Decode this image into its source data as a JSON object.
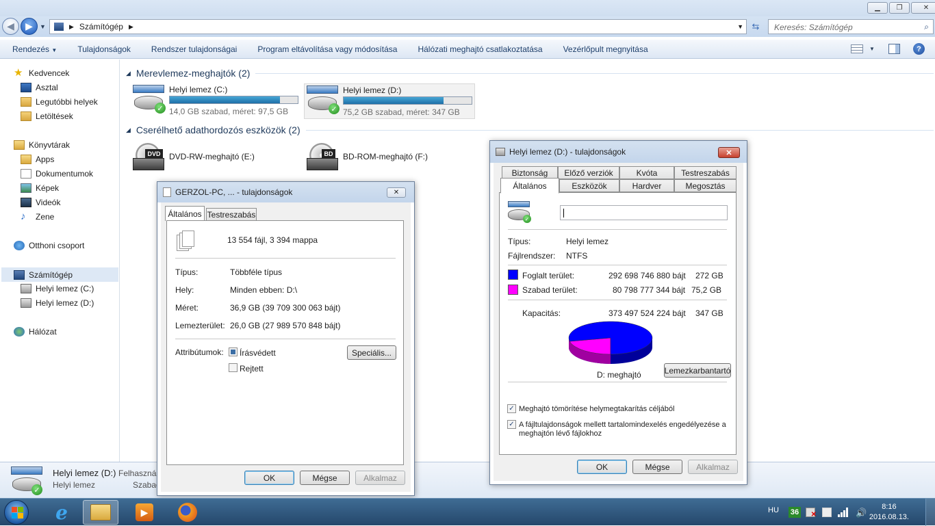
{
  "explorer": {
    "address": {
      "root_icon": "computer-icon",
      "path": "Számítógép"
    },
    "search": {
      "placeholder": "Keresés: Számítógép"
    },
    "commands": [
      "Rendezés",
      "Tulajdonságok",
      "Rendszer tulajdonságai",
      "Program eltávolítása vagy módosítása",
      "Hálózati meghajtó csatlakoztatása",
      "Vezérlőpult megnyitása"
    ],
    "nav": {
      "favorites": "Kedvencek",
      "fav_items": [
        "Asztal",
        "Legutóbbi helyek",
        "Letöltések"
      ],
      "libraries": "Könyvtárak",
      "lib_items": [
        "Apps",
        "Dokumentumok",
        "Képek",
        "Videók",
        "Zene"
      ],
      "homegroup": "Otthoni csoport",
      "computer": "Számítógép",
      "computer_items": [
        "Helyi lemez (C:)",
        "Helyi lemez (D:)"
      ],
      "network": "Hálózat"
    },
    "groups": {
      "hdd": "Merevlemez-meghajtók (2)",
      "removable": "Cserélhető adathordozós eszközök (2)"
    },
    "drives": [
      {
        "name": "Helyi lemez (C:)",
        "info": "14,0 GB szabad, méret: 97,5 GB",
        "used_fraction": 0.86
      },
      {
        "name": "Helyi lemez (D:)",
        "info": "75,2 GB szabad, méret: 347 GB",
        "used_fraction": 0.78
      }
    ],
    "removable": [
      {
        "name": "DVD-RW-meghajtó (E:)",
        "badge": "DVD"
      },
      {
        "name": "BD-ROM-meghajtó (F:)",
        "badge": "BD"
      }
    ],
    "details": {
      "name": "Helyi lemez (D:)",
      "type": "Helyi lemez",
      "col2a": "Felhasznált",
      "col2b": "Szabad"
    }
  },
  "multi_dialog": {
    "title": "GERZOL-PC, ... - tulajdonságok",
    "tabs": [
      "Általános",
      "Testreszabás"
    ],
    "summary": "13 554 fájl, 3 394 mappa",
    "rows": [
      {
        "label": "Típus:",
        "value": "Többféle típus"
      },
      {
        "label": "Hely:",
        "value": "Minden ebben: D:\\"
      },
      {
        "label": "Méret:",
        "value": "36,9 GB (39 709 300 063 bájt)"
      },
      {
        "label": "Lemezterület:",
        "value": "26,0 GB (27 989 570 848 bájt)"
      }
    ],
    "attributes_label": "Attribútumok:",
    "readonly_label": "Írásvédett",
    "hidden_label": "Rejtett",
    "special_button": "Speciális...",
    "ok": "OK",
    "cancel": "Mégse",
    "apply": "Alkalmaz"
  },
  "drive_dialog": {
    "title": "Helyi lemez (D:) - tulajdonságok",
    "tabs_row1": [
      "Biztonság",
      "Előző verziók",
      "Kvóta",
      "Testreszabás"
    ],
    "tabs_row2": [
      "Általános",
      "Eszközök",
      "Hardver",
      "Megosztás"
    ],
    "name_value": "",
    "type_label": "Típus:",
    "type_value": "Helyi lemez",
    "fs_label": "Fájlrendszer:",
    "fs_value": "NTFS",
    "used_label": "Foglalt terület:",
    "used_bytes": "292 698 746 880 bájt",
    "used_gb": "272 GB",
    "free_label": "Szabad terület:",
    "free_bytes": "80 798 777 344 bájt",
    "free_gb": "75,2 GB",
    "cap_label": "Kapacitás:",
    "cap_bytes": "373 497 524 224 bájt",
    "cap_gb": "347 GB",
    "used_color": "#0000ff",
    "free_color": "#ff00ff",
    "drive_label": "D: meghajtó",
    "cleanup_button": "Lemezkarbantartó",
    "compress_label": "Meghajtó tömörítése helymegtakarítás céljából",
    "index_label_1": "A fájltulajdonságok mellett tartalomindexelés engedélyezése a",
    "index_label_2": "meghajtón lévő fájlokhoz",
    "ok": "OK",
    "cancel": "Mégse",
    "apply": "Alkalmaz"
  },
  "taskbar": {
    "apps": [
      "start-orb-icon",
      "internet-explorer-icon",
      "explorer-icon",
      "media-player-icon",
      "firefox-icon"
    ],
    "lang": "HU",
    "badge": "36",
    "time": "8:16",
    "date": "2016.08.13."
  }
}
